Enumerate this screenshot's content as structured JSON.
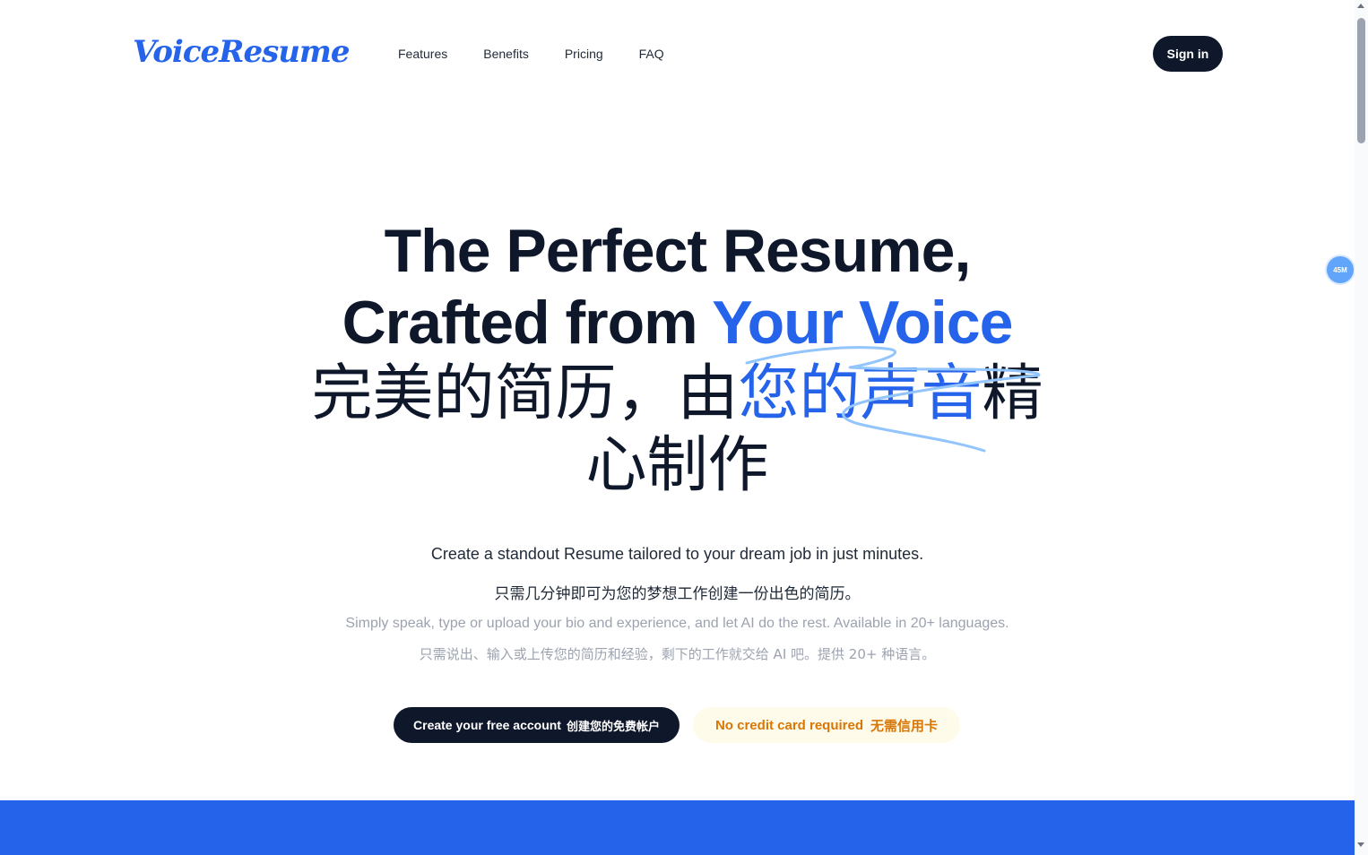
{
  "brand": {
    "logo": "VoiceResume",
    "accent_color": "#2563eb",
    "dark_color": "#0f172a"
  },
  "nav": {
    "items": [
      {
        "label": "Features"
      },
      {
        "label": "Benefits"
      },
      {
        "label": "Pricing"
      },
      {
        "label": "FAQ"
      }
    ],
    "signin_label": "Sign in"
  },
  "hero": {
    "line1": "The Perfect Resume,",
    "line2_prefix": "Crafted from ",
    "line2_accent": "Your Voice",
    "cn_line1_prefix": "完美的简历，由",
    "cn_line1_accent": "您的声音",
    "cn_line1_suffix": "精",
    "cn_line2": "心制作",
    "sub_en": "Create a standout Resume tailored to your dream job in just minutes.",
    "sub_cn": "只需几分钟即可为您的梦想工作创建一份出色的简历。",
    "desc_en": "Simply speak, type or upload your bio and experience, and let AI do the rest. Available in 20+ languages.",
    "desc_cn": "只需说出、输入或上传您的简历和经验，剩下的工作就交给 AI 吧。提供 20+ 种语言。"
  },
  "cta": {
    "create_en": "Create your free account",
    "create_cn": "创建您的免费帐户",
    "nocard_en": "No credit card required",
    "nocard_cn": "无需信用卡",
    "nocard_color": "#d97706"
  },
  "floating_badge": {
    "label": "45M"
  }
}
